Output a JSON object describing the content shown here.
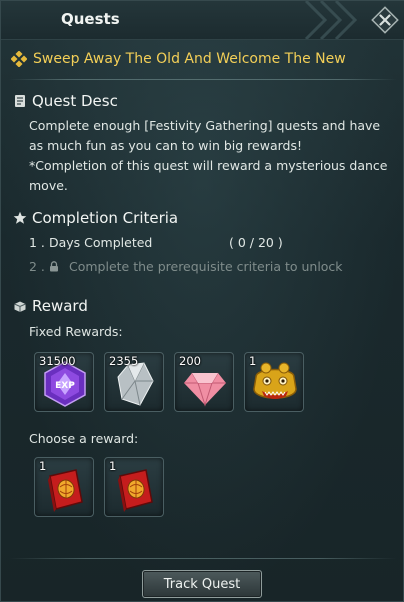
{
  "header": {
    "title": "Quests"
  },
  "quest": {
    "name": "Sweep Away The Old And Welcome The New"
  },
  "desc": {
    "heading": "Quest Desc",
    "line1": "Complete enough [Festivity Gathering] quests and have as much fun as you can to win big rewards!",
    "line2": "*Completion of this quest will reward a mysterious dance move."
  },
  "criteria": {
    "heading": "Completion Criteria",
    "items": [
      {
        "num": "1 .",
        "text": "Days Completed",
        "progress": "(   0 / 20 )"
      },
      {
        "num": "2 .",
        "text": "Complete the prerequisite criteria to unlock"
      }
    ]
  },
  "reward": {
    "heading": "Reward",
    "fixed_label": "Fixed Rewards:",
    "fixed": [
      {
        "qty": "31500",
        "icon": "exp-crystal-icon"
      },
      {
        "qty": "2355",
        "icon": "silver-crystal-icon"
      },
      {
        "qty": "200",
        "icon": "pink-gem-icon"
      },
      {
        "qty": "1",
        "icon": "golden-lion-head-icon"
      }
    ],
    "choose_label": "Choose a reward:",
    "choose": [
      {
        "qty": "1",
        "icon": "red-book-icon"
      },
      {
        "qty": "1",
        "icon": "red-book-icon"
      }
    ]
  },
  "footer": {
    "track_button": "Track Quest"
  },
  "colors": {
    "quest_title": "#f3cf57",
    "accent_gold": "#e5b93c",
    "panel_bg": "#1b2a2e"
  }
}
